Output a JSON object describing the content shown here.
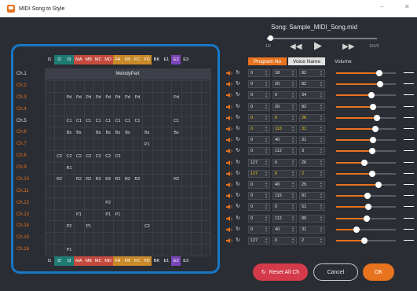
{
  "window": {
    "title": "MIDI Song to Style",
    "min": "–",
    "close": "✕"
  },
  "song": {
    "label": "Song: Sample_MIDI_Song.mid",
    "pos_start": "1/2",
    "pos_end": "101/3",
    "progress": 0.03
  },
  "parts_top": [
    {
      "l": "I1",
      "c": "#2a2d33"
    },
    {
      "l": "I2",
      "c": "#1f7a74"
    },
    {
      "l": "I3",
      "c": "#1f7a74"
    },
    {
      "l": "MA",
      "c": "#c44a3d"
    },
    {
      "l": "MB",
      "c": "#c44a3d"
    },
    {
      "l": "MC",
      "c": "#c44a3d"
    },
    {
      "l": "MD",
      "c": "#c44a3d"
    },
    {
      "l": "FA",
      "c": "#c98a2a"
    },
    {
      "l": "FB",
      "c": "#c98a2a"
    },
    {
      "l": "FC",
      "c": "#c98a2a"
    },
    {
      "l": "FD",
      "c": "#c98a2a"
    },
    {
      "l": "BK",
      "c": "#2a2d33"
    },
    {
      "l": "E1",
      "c": "#2a2d33"
    },
    {
      "l": "E2",
      "c": "#7a45b8"
    },
    {
      "l": "E3",
      "c": "#2a2d33"
    }
  ],
  "melody_label": "MelodyPart",
  "channels": [
    {
      "name": "Ch.1",
      "color": "#e0e0e0",
      "cells": []
    },
    {
      "name": "Ch.2",
      "color": "#e8731f",
      "cells": []
    },
    {
      "name": "Ch.3",
      "color": "#e8731f",
      "cells": [
        [
          2,
          "Pd"
        ],
        [
          3,
          "Pd"
        ],
        [
          4,
          "Pd"
        ],
        [
          5,
          "Pd"
        ],
        [
          6,
          "Pd"
        ],
        [
          7,
          "Pd"
        ],
        [
          8,
          "Pd"
        ],
        [
          9,
          "Pd"
        ],
        [
          13,
          "Pd"
        ]
      ]
    },
    {
      "name": "Ch.4",
      "color": "#e8731f",
      "cells": []
    },
    {
      "name": "Ch.5",
      "color": "#e0e0e0",
      "cells": [
        [
          2,
          "C1"
        ],
        [
          3,
          "C1"
        ],
        [
          4,
          "C1"
        ],
        [
          5,
          "C1"
        ],
        [
          6,
          "C1"
        ],
        [
          7,
          "C1"
        ],
        [
          8,
          "C1"
        ],
        [
          9,
          "C1"
        ],
        [
          13,
          "C1"
        ]
      ]
    },
    {
      "name": "Ch.6",
      "color": "#e8731f",
      "cells": [
        [
          2,
          "Bs"
        ],
        [
          3,
          "Bs"
        ],
        [
          5,
          "Bs"
        ],
        [
          6,
          "Bs"
        ],
        [
          7,
          "Bs"
        ],
        [
          8,
          "Bs"
        ],
        [
          10,
          "Bs"
        ],
        [
          13,
          "Bs"
        ]
      ]
    },
    {
      "name": "Ch.7",
      "color": "#e8731f",
      "cells": [
        [
          10,
          "P1"
        ]
      ]
    },
    {
      "name": "Ch.8",
      "color": "#e8731f",
      "cells": [
        [
          1,
          "C2"
        ],
        [
          2,
          "C2"
        ],
        [
          3,
          "C2"
        ],
        [
          4,
          "C2"
        ],
        [
          5,
          "C2"
        ],
        [
          6,
          "C2"
        ],
        [
          7,
          "C2"
        ]
      ]
    },
    {
      "name": "Ch.9",
      "color": "#e8731f",
      "cells": [
        [
          2,
          "R1"
        ]
      ]
    },
    {
      "name": "Ch.10",
      "color": "#e8731f",
      "cells": [
        [
          1,
          "R2"
        ],
        [
          3,
          "R2"
        ],
        [
          4,
          "R2"
        ],
        [
          5,
          "R2"
        ],
        [
          6,
          "R2"
        ],
        [
          7,
          "R2"
        ],
        [
          8,
          "R2"
        ],
        [
          9,
          "R2"
        ],
        [
          13,
          "R2"
        ]
      ]
    },
    {
      "name": "Ch.11",
      "color": "#e8731f",
      "cells": []
    },
    {
      "name": "Ch.12",
      "color": "#e8731f",
      "cells": [
        [
          6,
          "P2"
        ]
      ]
    },
    {
      "name": "Ch.13",
      "color": "#e8731f",
      "cells": [
        [
          3,
          "P1"
        ],
        [
          6,
          "P1"
        ],
        [
          7,
          "P1"
        ]
      ]
    },
    {
      "name": "Ch.14",
      "color": "#e8731f",
      "cells": [
        [
          2,
          "P2"
        ],
        [
          4,
          "P1"
        ],
        [
          10,
          "C2"
        ]
      ]
    },
    {
      "name": "Ch.15",
      "color": "#e8731f",
      "cells": []
    },
    {
      "name": "Ch.16",
      "color": "#e8731f",
      "cells": [
        [
          2,
          "P1"
        ]
      ]
    }
  ],
  "parts_bottom": [
    {
      "l": "I1",
      "c": "#2a2d33"
    },
    {
      "l": "I2",
      "c": "#1f7a74"
    },
    {
      "l": "I3",
      "c": "#1f7a74"
    },
    {
      "l": "MA",
      "c": "#c44a3d"
    },
    {
      "l": "MB",
      "c": "#c44a3d"
    },
    {
      "l": "MC",
      "c": "#c44a3d"
    },
    {
      "l": "MD",
      "c": "#c44a3d"
    },
    {
      "l": "FA",
      "c": "#c98a2a"
    },
    {
      "l": "FB",
      "c": "#c98a2a"
    },
    {
      "l": "FC",
      "c": "#c98a2a"
    },
    {
      "l": "FD",
      "c": "#c98a2a"
    },
    {
      "l": "BK",
      "c": "#2a2d33"
    },
    {
      "l": "E1",
      "c": "#2a2d33"
    },
    {
      "l": "E2",
      "c": "#7a45b8"
    },
    {
      "l": "E3",
      "c": "#2a2d33"
    }
  ],
  "headers": {
    "program": "Program No",
    "voice": "Voice Name",
    "volume": "Volume"
  },
  "rows": [
    {
      "a": "0",
      "b": "18",
      "c": "82",
      "v": 0.72,
      "y": false
    },
    {
      "a": "0",
      "b": "20",
      "c": "82",
      "v": 0.74,
      "y": false
    },
    {
      "a": "0",
      "b": "0",
      "c": "34",
      "v": 0.59,
      "y": false
    },
    {
      "a": "0",
      "b": "20",
      "c": "82",
      "v": 0.62,
      "y": false
    },
    {
      "a": "0",
      "b": "0",
      "c": "26",
      "v": 0.68,
      "y": true
    },
    {
      "a": "0",
      "b": "113",
      "c": "31",
      "v": 0.66,
      "y": true
    },
    {
      "a": "0",
      "b": "40",
      "c": "31",
      "v": 0.62,
      "y": false
    },
    {
      "a": "0",
      "b": "112",
      "c": "3",
      "v": 0.61,
      "y": false
    },
    {
      "a": "127",
      "b": "0",
      "c": "26",
      "v": 0.47,
      "y": false
    },
    {
      "a": "127",
      "b": "0",
      "c": "2",
      "v": 0.61,
      "y": true
    },
    {
      "a": "0",
      "b": "40",
      "c": "29",
      "v": 0.71,
      "y": false
    },
    {
      "a": "0",
      "b": "115",
      "c": "81",
      "v": 0.52,
      "y": false
    },
    {
      "a": "0",
      "b": "0",
      "c": "51",
      "v": 0.54,
      "y": false
    },
    {
      "a": "0",
      "b": "112",
      "c": "89",
      "v": 0.51,
      "y": false
    },
    {
      "a": "0",
      "b": "40",
      "c": "31",
      "v": 0.34,
      "y": false
    },
    {
      "a": "127",
      "b": "0",
      "c": "2",
      "v": 0.48,
      "y": false
    }
  ],
  "buttons": {
    "reset": "Reset All Ch",
    "cancel": "Cancel",
    "ok": "OK"
  },
  "colors": {
    "accent": "#e8731f",
    "reset": "#d43a4a",
    "highlight": "#1778c8"
  }
}
